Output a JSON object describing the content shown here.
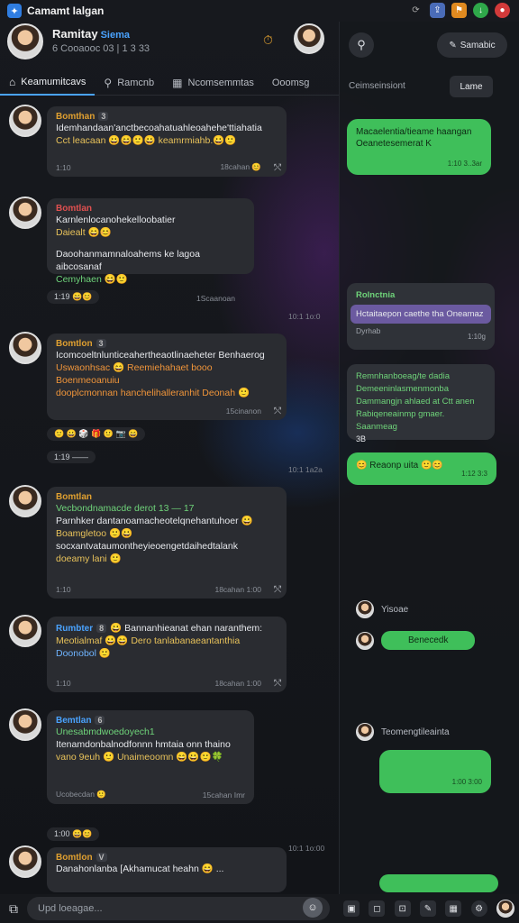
{
  "app": {
    "title": "Camamt Ialgan"
  },
  "status_icons": [
    "refresh-icon",
    "share-icon",
    "flag-icon",
    "download-icon",
    "record-icon"
  ],
  "profile": {
    "name": "Ramitay",
    "badge": "Siema",
    "sub": "6 Cooaooc 03 | 1 3 33"
  },
  "tabs": [
    {
      "label": "Keamumitcavs",
      "icon": "home-icon"
    },
    {
      "label": "Ramcnb",
      "icon": "search-icon"
    },
    {
      "label": "Ncomsemmtas",
      "icon": "grid-icon"
    },
    {
      "label": "Ooomsg",
      "icon": ""
    }
  ],
  "messages": [
    {
      "sender": "Bomthan",
      "tag": "3",
      "sender_color": "#e0a030",
      "lines": "Idemhandaan'anctbecoahatuahleoahehe'ttiahatia",
      "lines2": "Cct leacaan 😀😄🙂😀 keamrmiahb.😀🙂",
      "l2class": "yellow",
      "meta_l": "1:10",
      "meta_r": "18cahan 😊"
    },
    {
      "sender": "Bomtlan",
      "tag": "",
      "sender_color": "#e05050",
      "lines": "Karnlenlocanohekelloobatier",
      "lines2": "Daiealt 😄😊",
      "l2class": "yellow",
      "lines3": "Daoohanmamnaloahems ke lagoa aibcosanaf",
      "lines4": "Cemyhaen 😄🙂",
      "meta_l": "1:19 😄😊",
      "meta_r": "1Scaanoan",
      "side_time": "10:1 1o:0"
    },
    {
      "sender": "Bomtlon",
      "tag": "3",
      "sender_color": "#e0a030",
      "lines": "Icomcoeltnlunticeahertheaotlinaeheter Benhaerog",
      "lines2": "Uswaonhsac 😄 Reemiehahaet booo Boenmeoanuiu",
      "lines3": "dooplcmonnan hanchelihalleranhit Deonah 🙂",
      "l2class": "orange",
      "meta_l": "",
      "meta_r": "15cinanon",
      "reacts": "🙂 😀 🎲 🎁 🙂 📷 😄",
      "react_pill": "1:19 ——",
      "side_time": "10:1 1a2a"
    },
    {
      "sender": "Bomtlan",
      "tag": "",
      "sender_color": "#e0a030",
      "lines": "Vecbondnamacde derot 13 — 17",
      "lines2": "Parnhker dantanoamacheotelqnehantuhoer 😀",
      "lines3": "Boamgletoo 🙂😀",
      "lines4": "socxantvataumontheyieoengetdaihedtalank",
      "lines5": "doeamy lani 🙂",
      "l1class": "green",
      "meta_l": "1:10",
      "meta_r": "18cahan 1:00"
    },
    {
      "sender": "Rumbter",
      "tag": "8",
      "sender_color": "#4aa3ff",
      "lines": "😀 Bannanhieanat ehan naranthem:",
      "lines2": "Meotialmaf 😀😄 Dero tanlabanaeantanthia",
      "lines3": "Doonobol 🙂",
      "l2class": "yellow",
      "l3class": "blue",
      "meta_l": "1:10",
      "meta_r": "18cahan 1:00"
    },
    {
      "sender": "Bemtlan",
      "tag": "6",
      "sender_color": "#4aa3ff",
      "lines": "Unesabmdwoedoyech1",
      "lines2": "Itenamdonbalnodfonnn hmtaia onn thaino",
      "lines3": "vano 9euh 🙂 Unaimeoomn 😄😀🙂🍀",
      "l1class": "green",
      "meta_l": "Ucobecdan 🙂",
      "meta_r": "15cahan Imr",
      "react_pill": "1:00 😀😊",
      "side_time": "10:1 1o:00"
    },
    {
      "sender": "Bomtlon",
      "tag": "V",
      "sender_color": "#e0a030",
      "lines": "Danahonlanba [Akhamucat heahn 😄 ...",
      "meta_l": "",
      "meta_r": ""
    }
  ],
  "right": {
    "search_icon": "search-icon",
    "button_label": "Samabic",
    "section_title": "Ceimseinsiont",
    "pill_label": "Lame",
    "bubbles": [
      {
        "text": "Macaelentia/tieame haangan Oeanetesemerat K",
        "time": "1:10 3..3ar"
      },
      {
        "header": "Rolnctnia",
        "text": "Hctaitaepon caethe tha Oneamaz",
        "sub": "Dyrhab",
        "time": "1:10g"
      },
      {
        "text": "Remnhanboeag/te dadia Demeeninlasmenmonba Dammangjn ahlaed at Ctt anen Rabiqeneainmp gmaer. Saanmeag",
        "extra": "3B"
      },
      {
        "text": "😊 Reaonp uita 🙂😊",
        "time": "1:12 3:3"
      }
    ],
    "rows": [
      {
        "label": "Yisoae"
      },
      {
        "label": "Benecedk"
      },
      {
        "label": "Teomengtileainta"
      }
    ],
    "last_time": "1:00 3:00"
  },
  "composer": {
    "placeholder": "Upd loeagae..."
  }
}
